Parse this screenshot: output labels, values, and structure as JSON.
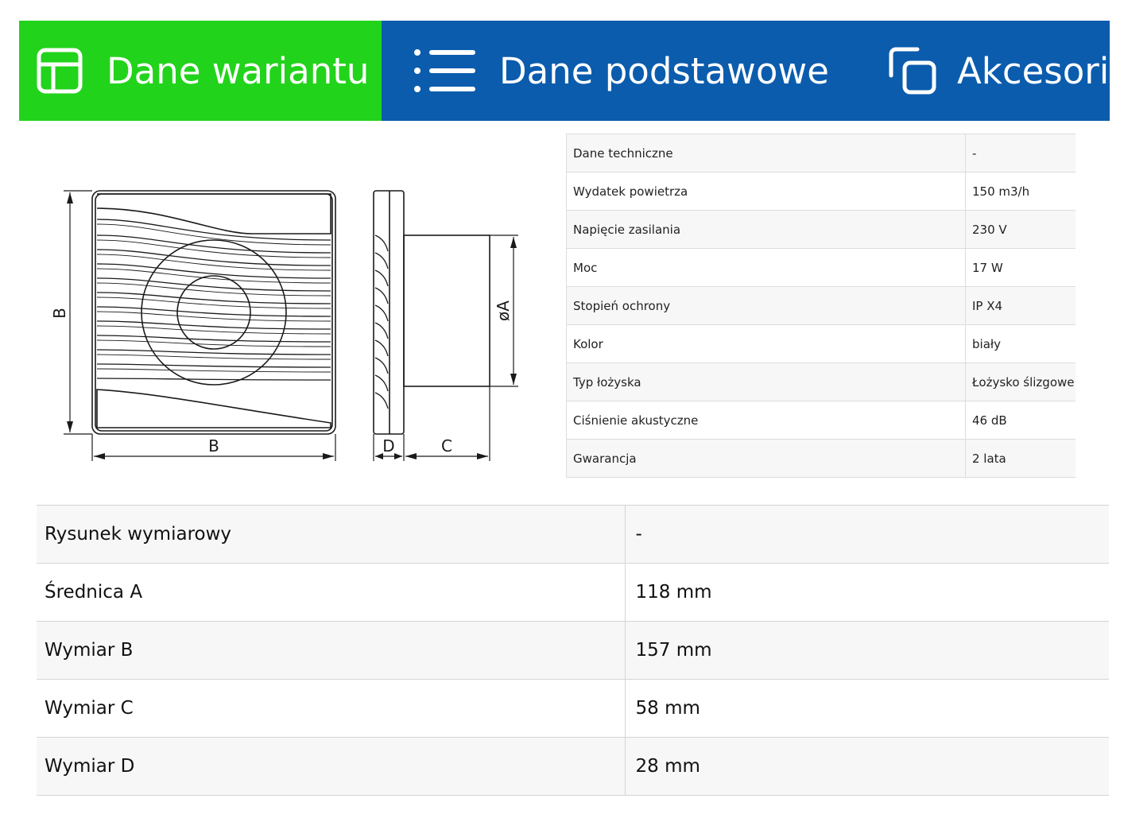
{
  "colors": {
    "tab_active": "#22d31b",
    "tab_inactive": "#0b5cad",
    "tab_text": "#ffffff"
  },
  "tabs": [
    {
      "label": "Dane wariantu",
      "icon": "layout-icon",
      "active": true
    },
    {
      "label": "Dane podstawowe",
      "icon": "list-icon",
      "active": false
    },
    {
      "label": "Akcesoria",
      "icon": "copy-icon",
      "active": false
    }
  ],
  "drawing": {
    "labels": {
      "b_vertical": "B",
      "b_horizontal": "B",
      "d": "D",
      "c": "C",
      "diameter_a": "øA"
    }
  },
  "specs": {
    "rows": [
      {
        "label": "Dane techniczne",
        "value": "-"
      },
      {
        "label": "Wydatek powietrza",
        "value": "150 m3/h"
      },
      {
        "label": "Napięcie zasilania",
        "value": "230 V"
      },
      {
        "label": "Moc",
        "value": "17 W"
      },
      {
        "label": "Stopień ochrony",
        "value": "IP X4"
      },
      {
        "label": "Kolor",
        "value": "biały"
      },
      {
        "label": "Typ łożyska",
        "value": "Łożysko ślizgowe"
      },
      {
        "label": "Ciśnienie akustyczne",
        "value": "46 dB"
      },
      {
        "label": "Gwarancja",
        "value": "2 lata"
      }
    ]
  },
  "dimensions": {
    "rows": [
      {
        "label": "Rysunek wymiarowy",
        "value": "-"
      },
      {
        "label": "Średnica A",
        "value": "118 mm"
      },
      {
        "label": "Wymiar B",
        "value": "157 mm"
      },
      {
        "label": "Wymiar C",
        "value": "58 mm"
      },
      {
        "label": "Wymiar D",
        "value": "28 mm"
      }
    ]
  }
}
